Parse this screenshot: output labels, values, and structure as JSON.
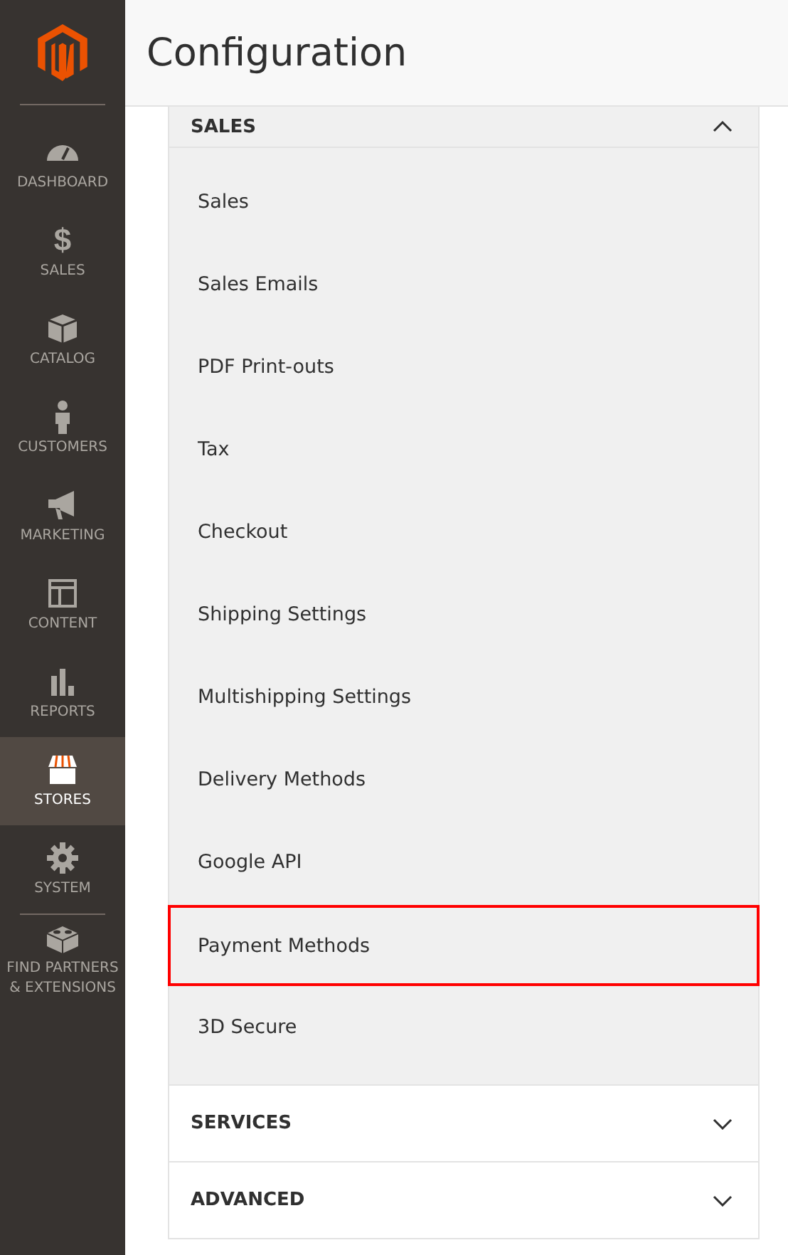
{
  "sidebar": {
    "items": [
      {
        "label": "DASHBOARD",
        "selected": false
      },
      {
        "label": "SALES",
        "glyph": "$",
        "selected": false
      },
      {
        "label": "CATALOG",
        "selected": false
      },
      {
        "label": "CUSTOMERS",
        "selected": false
      },
      {
        "label": "MARKETING",
        "selected": false
      },
      {
        "label": "CONTENT",
        "selected": false
      },
      {
        "label": "REPORTS",
        "selected": false
      },
      {
        "label": "STORES",
        "selected": true
      },
      {
        "label": "SYSTEM",
        "selected": false
      },
      {
        "label": "FIND PARTNERS & EXTENSIONS",
        "selected": false
      }
    ]
  },
  "page_title": "Configuration",
  "sections": [
    {
      "title": "SALES",
      "expanded": true,
      "items": [
        {
          "label": "Sales",
          "highlighted": false
        },
        {
          "label": "Sales Emails",
          "highlighted": false
        },
        {
          "label": "PDF Print-outs",
          "highlighted": false
        },
        {
          "label": "Tax",
          "highlighted": false
        },
        {
          "label": "Checkout",
          "highlighted": false
        },
        {
          "label": "Shipping Settings",
          "highlighted": false
        },
        {
          "label": "Multishipping Settings",
          "highlighted": false
        },
        {
          "label": "Delivery Methods",
          "highlighted": false
        },
        {
          "label": "Google API",
          "highlighted": false
        },
        {
          "label": "Payment Methods",
          "highlighted": true
        },
        {
          "label": "3D Secure",
          "highlighted": false
        }
      ]
    },
    {
      "title": "SERVICES",
      "expanded": false
    },
    {
      "title": "ADVANCED",
      "expanded": false
    }
  ]
}
